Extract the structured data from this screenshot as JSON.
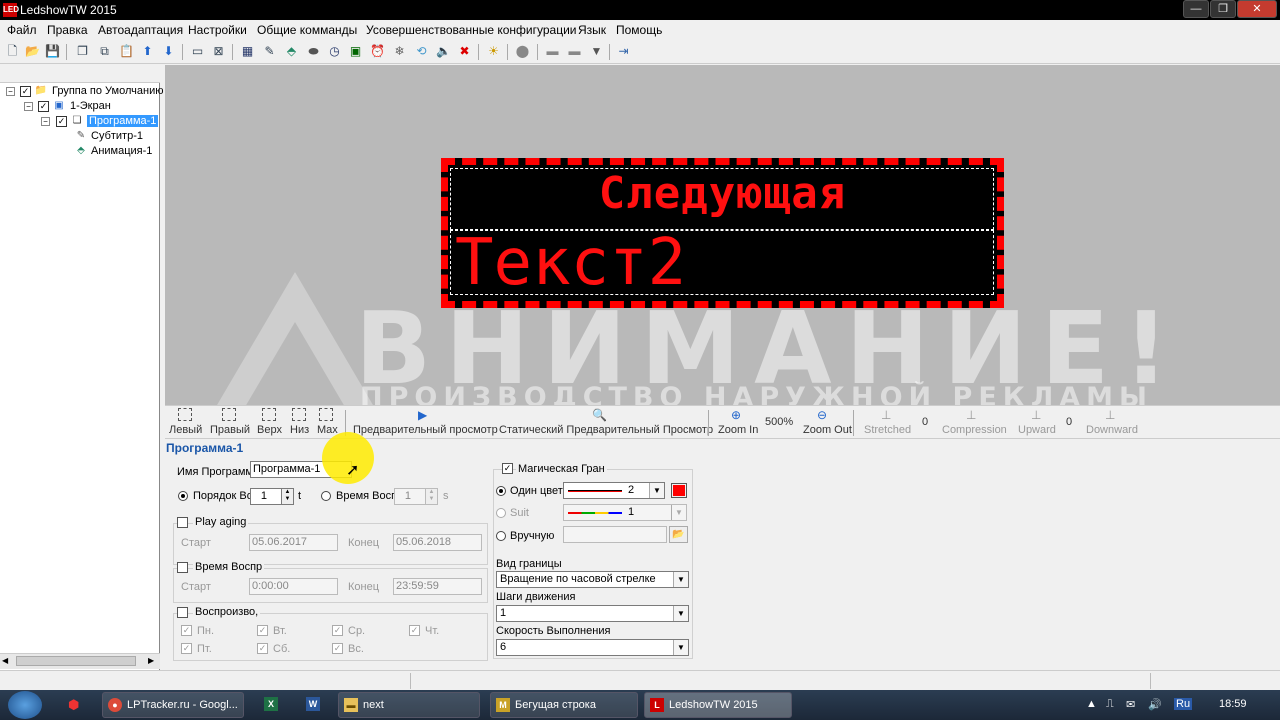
{
  "window": {
    "title": "LedshowTW 2015",
    "app_icon": "LED",
    "minimize": "—",
    "maximize": "❐",
    "close": "✕"
  },
  "menu": [
    "Файл",
    "Правка",
    "Автоадаптация",
    "Настройки",
    "Общие комманды",
    "Усовершенствованные конфигурации",
    "Язык",
    "Помощь"
  ],
  "tree": {
    "group": "Группа по Умолчанию",
    "screen": "1-Экран",
    "program": "Программа-1",
    "subtitle": "Субтитр-1",
    "animation": "Анимация-1"
  },
  "led": {
    "line1": "Следующая",
    "line2": "Текст2",
    "color": "#ff1010"
  },
  "watermark": {
    "big": "ВНИМАНИЕ!",
    "small": "ПРОИЗВОДСТВО НАРУЖНОЙ РЕКЛАМЫ"
  },
  "ptoolbar": {
    "left": "Левый",
    "right": "Правый",
    "top": "Верх",
    "bottom": "Низ",
    "max": "Max",
    "preview": "Предварительный просмотр",
    "static_preview": "Статический Предварительный Просмотр",
    "zoom_pct": "500%",
    "zoom_in": "Zoom In",
    "zoom_out": "Zoom Out",
    "stretched": "Stretched",
    "stretched_val": "0",
    "compression": "Compression",
    "upward": "Upward",
    "upward_val": "0",
    "downward": "Downward"
  },
  "props": {
    "title": "Программа-1",
    "name_label": "Имя Программы",
    "name_value": "Программа-1",
    "order_label": "Порядок Во",
    "order_value": "1",
    "order_unit": "t",
    "time_label": "Время Воспр",
    "time_value": "1",
    "time_unit": "s",
    "play_aging": "Play aging",
    "start_label": "Старт",
    "start_date": "05.06.2017",
    "end_label": "Конец",
    "end_date": "05.06.2018",
    "play_time": "Время Воспр",
    "start_time": "0:00:00",
    "end_time": "23:59:59",
    "playback": "Воспроизво,",
    "days": [
      "Пн.",
      "Вт.",
      "Ср.",
      "Чт.",
      "Пт.",
      "Сб.",
      "Вс."
    ],
    "magic_border": "Магическая Гран",
    "one_color": "Один цвет",
    "one_color_val": "2",
    "suit": "Suit",
    "suit_val": "1",
    "manual": "Вручную",
    "border_type_label": "Вид границы",
    "border_type": "Вращение по часовой стрелке",
    "steps_label": "Шаги движения",
    "steps": "1",
    "speed_label": "Скорость Выполнения",
    "speed": "6",
    "accent_color": "#ff0000"
  },
  "taskbar": {
    "items": [
      "LPTracker.ru - Googl...",
      "next",
      "Бегущая строка",
      "LedshowTW 2015"
    ],
    "lang": "Ru",
    "clock": "18:59"
  }
}
